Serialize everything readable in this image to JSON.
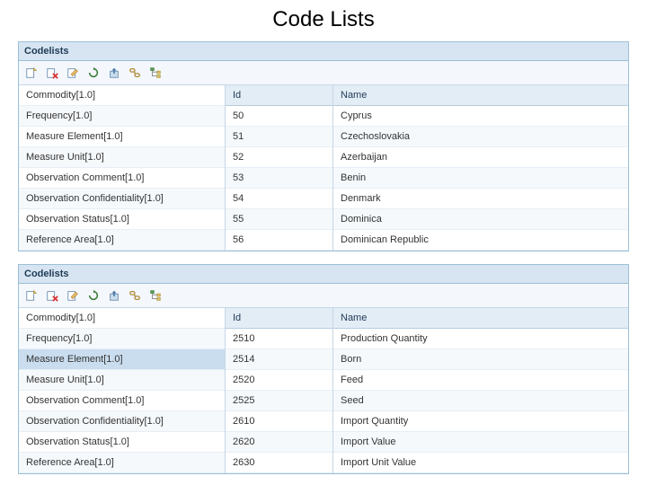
{
  "page": {
    "title": "Code Lists"
  },
  "panel_label": "Codelists",
  "columns": {
    "id": "Id",
    "name": "Name"
  },
  "toolbar_icons": [
    "new-icon",
    "delete-icon",
    "edit-icon",
    "refresh-icon",
    "export-icon",
    "link-icon",
    "tree-icon"
  ],
  "panel_top": {
    "codelists": [
      "Commodity[1.0]",
      "Frequency[1.0]",
      "Measure Element[1.0]",
      "Measure Unit[1.0]",
      "Observation Comment[1.0]",
      "Observation Confidentiality[1.0]",
      "Observation Status[1.0]",
      "Reference Area[1.0]"
    ],
    "selected_index": -1,
    "rows": [
      {
        "id": "50",
        "name": "Cyprus"
      },
      {
        "id": "51",
        "name": "Czechoslovakia"
      },
      {
        "id": "52",
        "name": "Azerbaijan"
      },
      {
        "id": "53",
        "name": "Benin"
      },
      {
        "id": "54",
        "name": "Denmark"
      },
      {
        "id": "55",
        "name": "Dominica"
      },
      {
        "id": "56",
        "name": "Dominican Republic"
      }
    ]
  },
  "panel_bottom": {
    "codelists": [
      "Commodity[1.0]",
      "Frequency[1.0]",
      "Measure Element[1.0]",
      "Measure Unit[1.0]",
      "Observation Comment[1.0]",
      "Observation Confidentiality[1.0]",
      "Observation Status[1.0]",
      "Reference Area[1.0]"
    ],
    "selected_index": 2,
    "rows": [
      {
        "id": "2510",
        "name": "Production Quantity"
      },
      {
        "id": "2514",
        "name": "Born"
      },
      {
        "id": "2520",
        "name": "Feed"
      },
      {
        "id": "2525",
        "name": "Seed"
      },
      {
        "id": "2610",
        "name": "Import Quantity"
      },
      {
        "id": "2620",
        "name": "Import Value"
      },
      {
        "id": "2630",
        "name": "Import Unit Value"
      }
    ]
  }
}
